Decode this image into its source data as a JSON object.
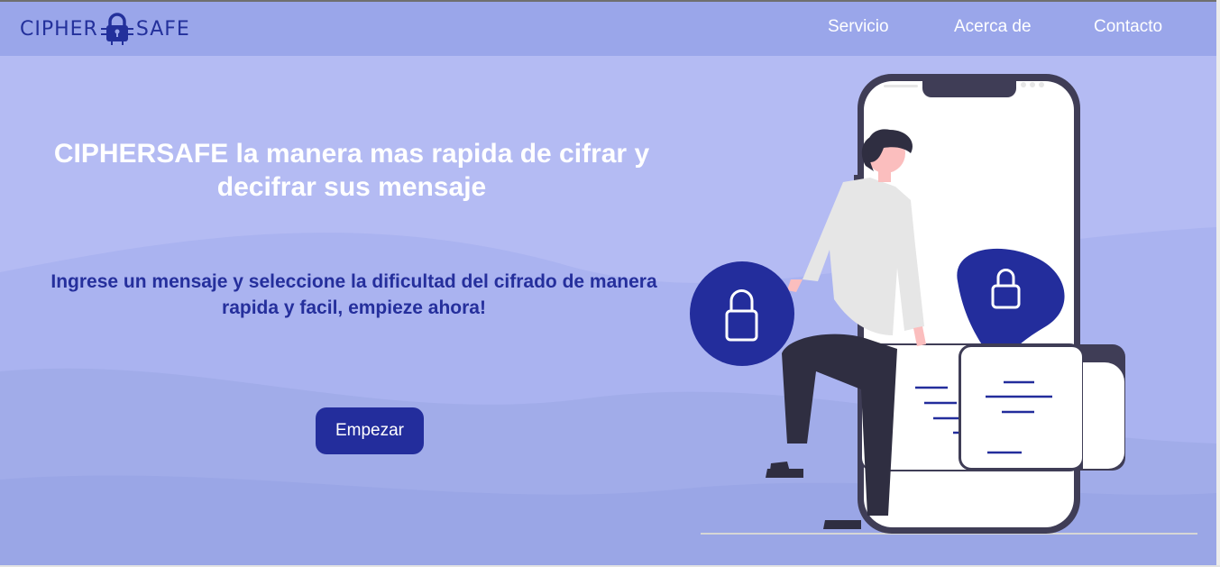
{
  "brand": {
    "left_word": "CIPHER",
    "right_word": "SAFE",
    "icon": "lock-icon"
  },
  "nav": {
    "servicio": "Servicio",
    "acerca": "Acerca de",
    "contacto": "Contacto"
  },
  "hero": {
    "title": "CIPHERSAFE la manera mas rapida de cifrar y decifrar sus mensaje",
    "subtitle": "Ingrese un mensaje y seleccione la dificultad del cifrado de manera rapida y facil, empieze ahora!",
    "cta_label": "Empezar"
  },
  "illustration": {
    "icons": [
      "lock-icon",
      "person-figure",
      "phone-illustration",
      "message-card-icon"
    ]
  },
  "colors": {
    "header_bg": "#9aa6ea",
    "hero_bg": "#b4bbf3",
    "accent": "#232d9c",
    "text_light": "#ffffff"
  }
}
